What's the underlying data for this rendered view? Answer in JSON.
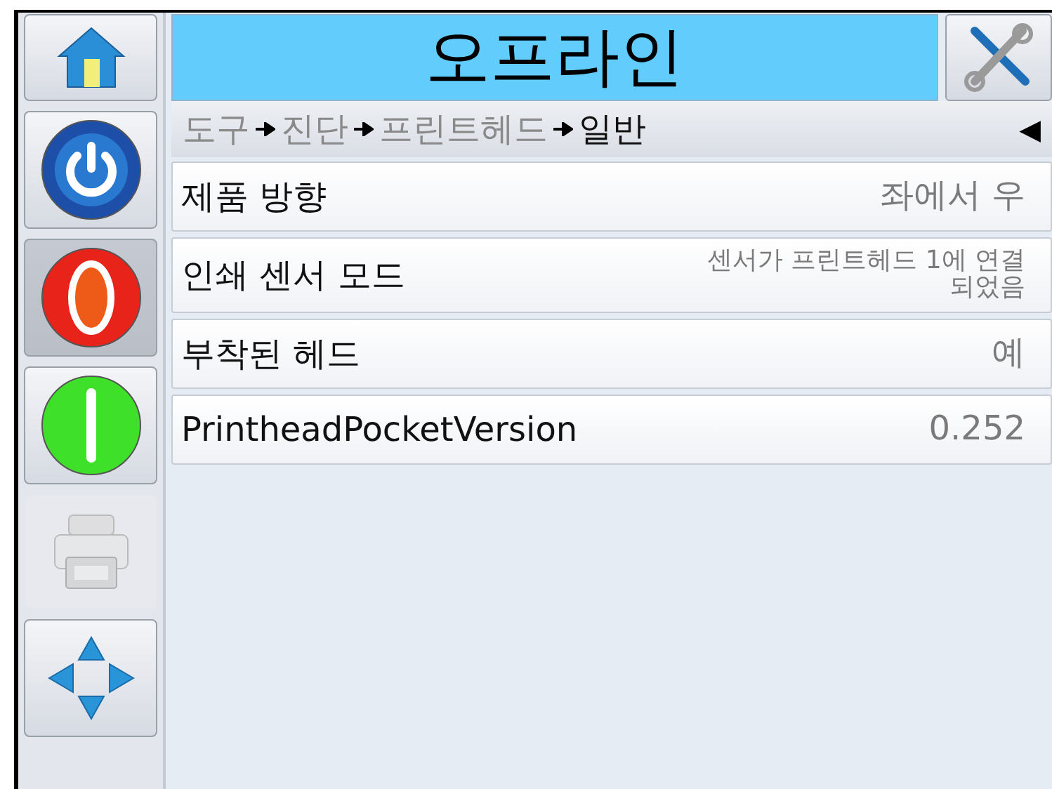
{
  "header": {
    "title": "오프라인"
  },
  "side_buttons": [
    {
      "kind": "home",
      "selected": false,
      "disabled": false
    },
    {
      "kind": "power",
      "selected": false,
      "disabled": false
    },
    {
      "kind": "stop",
      "selected": true,
      "disabled": false
    },
    {
      "kind": "start",
      "selected": false,
      "disabled": false
    },
    {
      "kind": "printer",
      "selected": false,
      "disabled": true
    },
    {
      "kind": "navigate",
      "selected": false,
      "disabled": false
    }
  ],
  "breadcrumb": [
    {
      "label": "도구",
      "current": false
    },
    {
      "label": "진단",
      "current": false
    },
    {
      "label": "프린트헤드",
      "current": false
    },
    {
      "label": "일반",
      "current": true
    }
  ],
  "back_glyph": "◀",
  "rows": [
    {
      "label": "제품 방향",
      "value": [
        "좌에서 우"
      ]
    },
    {
      "label": "인쇄 센서 모드",
      "value": [
        "센서가 프린트헤드 1에 연결",
        "되었음"
      ]
    },
    {
      "label": "부착된 헤드",
      "value": [
        "예"
      ]
    },
    {
      "label": "PrintheadPocketVersion",
      "value": [
        "0.252"
      ]
    }
  ]
}
